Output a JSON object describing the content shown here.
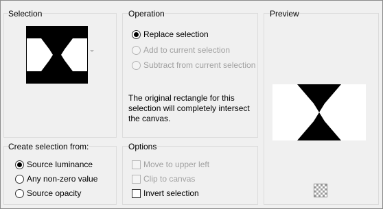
{
  "selection_group": {
    "title": "Selection",
    "thumbnail_icon": "hourglass-shape"
  },
  "operation_group": {
    "title": "Operation",
    "options": [
      {
        "label": "Replace selection",
        "checked": true,
        "enabled": true
      },
      {
        "label": "Add to current selection",
        "checked": false,
        "enabled": false
      },
      {
        "label": "Subtract from current selection",
        "checked": false,
        "enabled": false
      }
    ],
    "info_text": "The original rectangle for this selection will completely intersect the canvas."
  },
  "preview_group": {
    "title": "Preview",
    "transparency_toggle_icon": "checkerboard-icon"
  },
  "create_group": {
    "title": "Create selection from:",
    "options": [
      {
        "label": "Source luminance",
        "checked": true
      },
      {
        "label": "Any non-zero value",
        "checked": false
      },
      {
        "label": "Source opacity",
        "checked": false
      }
    ]
  },
  "options_group": {
    "title": "Options",
    "items": [
      {
        "label": "Move to upper left",
        "checked": false,
        "enabled": false
      },
      {
        "label": "Clip to canvas",
        "checked": false,
        "enabled": false
      },
      {
        "label": "Invert selection",
        "checked": false,
        "enabled": true
      }
    ]
  }
}
